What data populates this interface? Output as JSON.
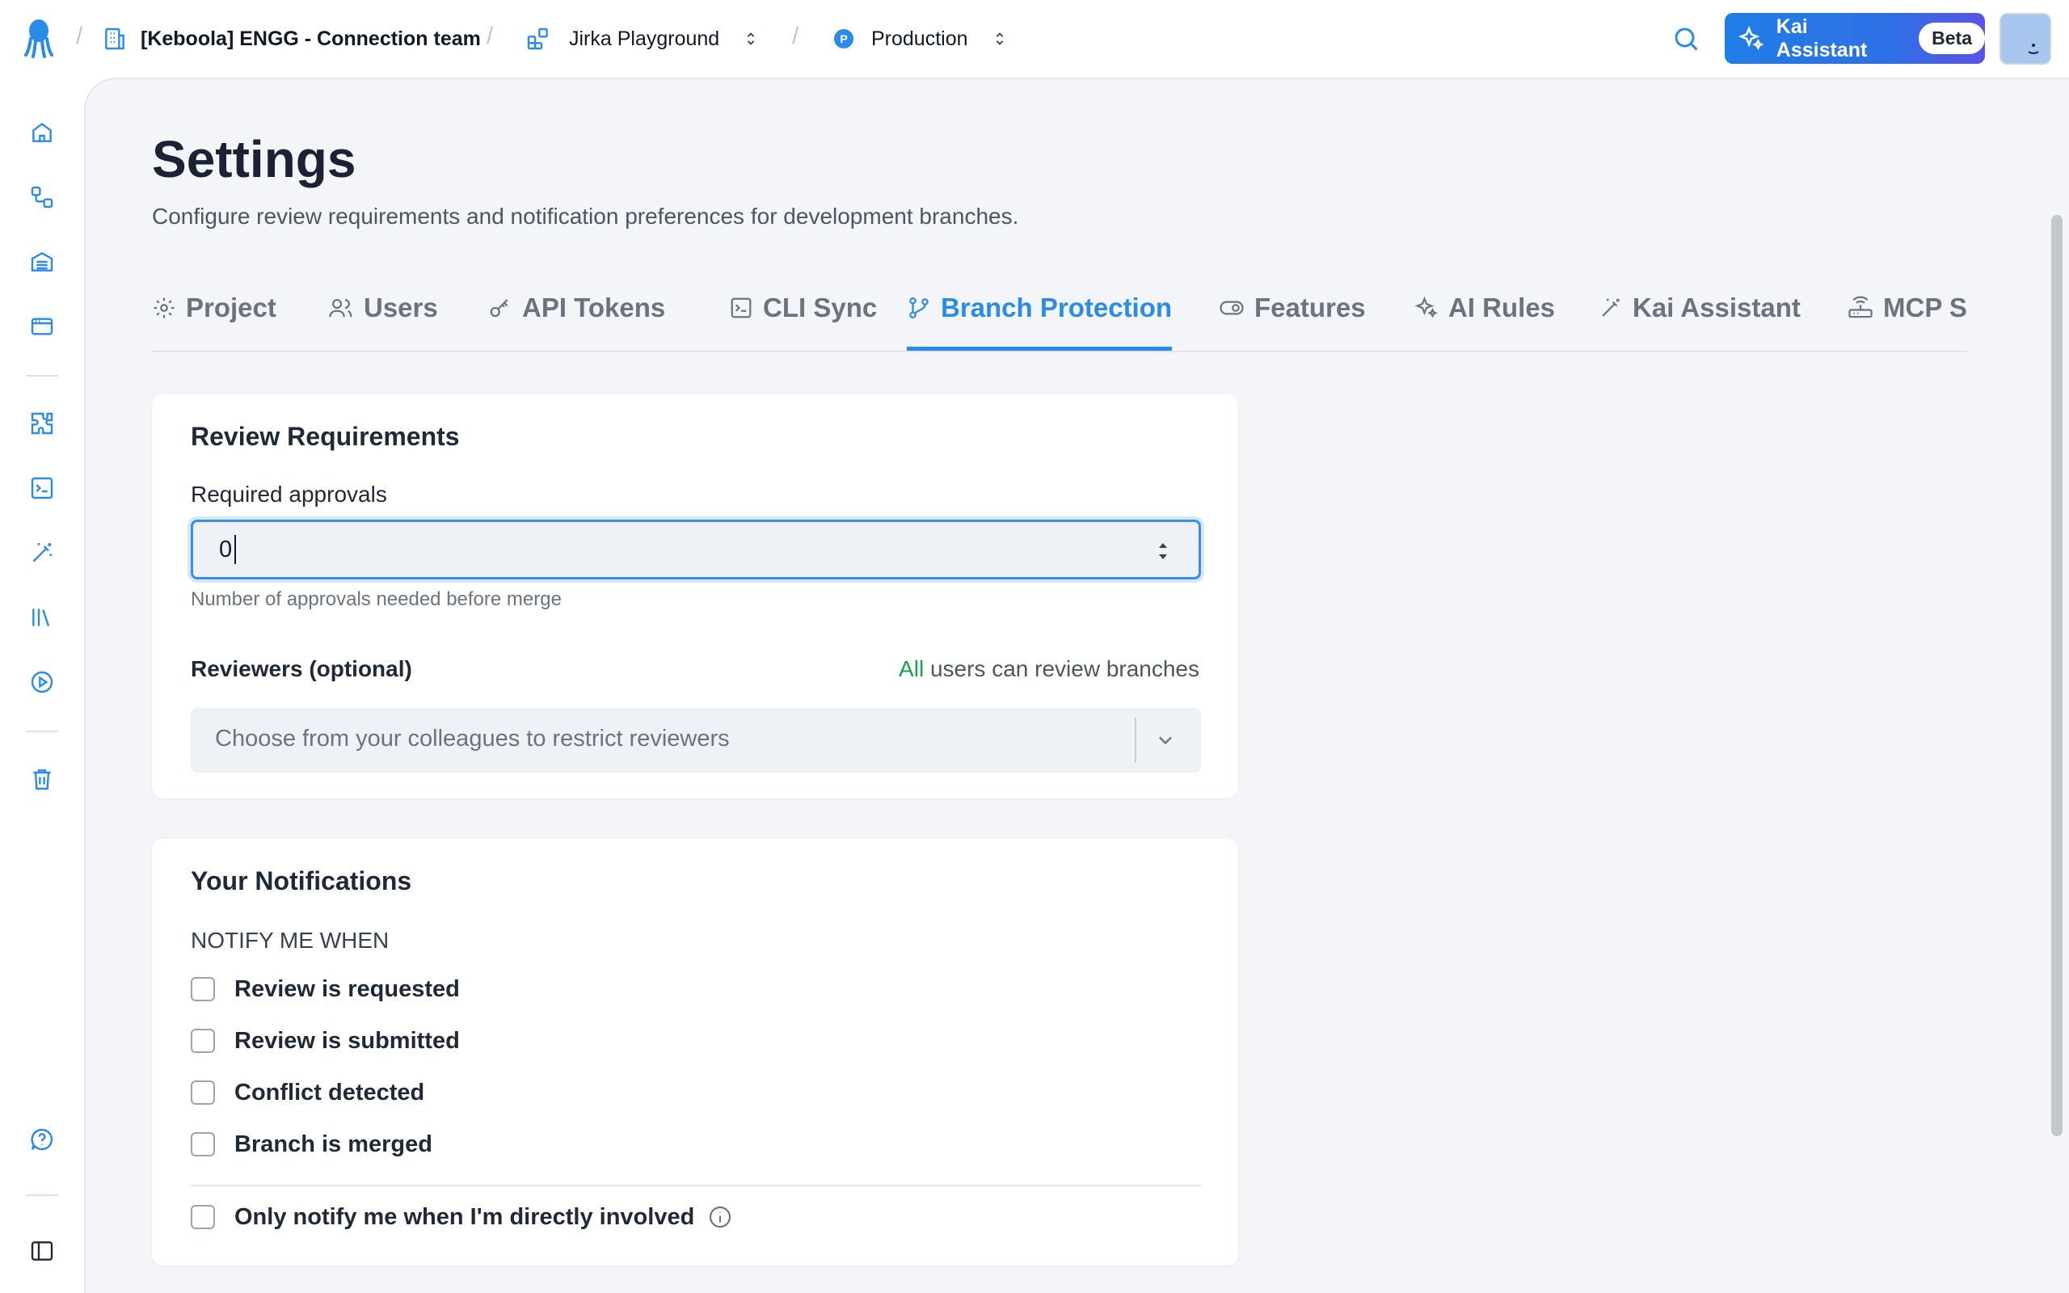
{
  "header": {
    "org_name": "[Keboola] ENGG - Connection team",
    "project_name": "Jirka Playground",
    "branch_badge": "P",
    "branch_name": "Production",
    "kai_button_label": "Kai Assistant",
    "kai_badge": "Beta"
  },
  "sidebar": {
    "items": [
      "home-icon",
      "flows-icon",
      "storage-icon",
      "workspaces-icon",
      "components-icon",
      "transformations-icon",
      "ai-wand-icon",
      "library-icon",
      "jobs-icon",
      "trash-icon",
      "help-icon",
      "collapse-sidebar-icon"
    ]
  },
  "page": {
    "title": "Settings",
    "subtitle": "Configure review requirements and notification preferences for development branches."
  },
  "tabs": [
    {
      "label": "Project",
      "icon": "gear-icon",
      "active": false
    },
    {
      "label": "Users",
      "icon": "users-icon",
      "active": false
    },
    {
      "label": "API Tokens",
      "icon": "key-icon",
      "active": false
    },
    {
      "label": "CLI Sync",
      "icon": "terminal-icon",
      "active": false
    },
    {
      "label": "Branch Protection",
      "icon": "branch-icon",
      "active": true
    },
    {
      "label": "Features",
      "icon": "toggle-icon",
      "active": false
    },
    {
      "label": "AI Rules",
      "icon": "sparkles-icon",
      "active": false
    },
    {
      "label": "Kai Assistant",
      "icon": "wand-icon",
      "active": false
    },
    {
      "label": "MCP Se",
      "icon": "router-icon",
      "active": false
    }
  ],
  "review": {
    "title": "Review Requirements",
    "approvals_label": "Required approvals",
    "approvals_value": "0",
    "approvals_hint": "Number of approvals needed before merge",
    "reviewers_label": "Reviewers (optional)",
    "reviewers_note_all": "All",
    "reviewers_note_rest": " users can review branches",
    "reviewers_placeholder": "Choose from your colleagues to restrict reviewers"
  },
  "notifications": {
    "title": "Your Notifications",
    "section_label": "NOTIFY ME WHEN",
    "options": [
      {
        "label": "Review is requested",
        "checked": false
      },
      {
        "label": "Review is submitted",
        "checked": false
      },
      {
        "label": "Conflict detected",
        "checked": false
      },
      {
        "label": "Branch is merged",
        "checked": false
      }
    ],
    "direct_only_label": "Only notify me when I'm directly involved",
    "direct_only_checked": false
  },
  "colors": {
    "accent": "#2a8ce8",
    "success": "#16a34a",
    "background": "#f3f5f8"
  }
}
